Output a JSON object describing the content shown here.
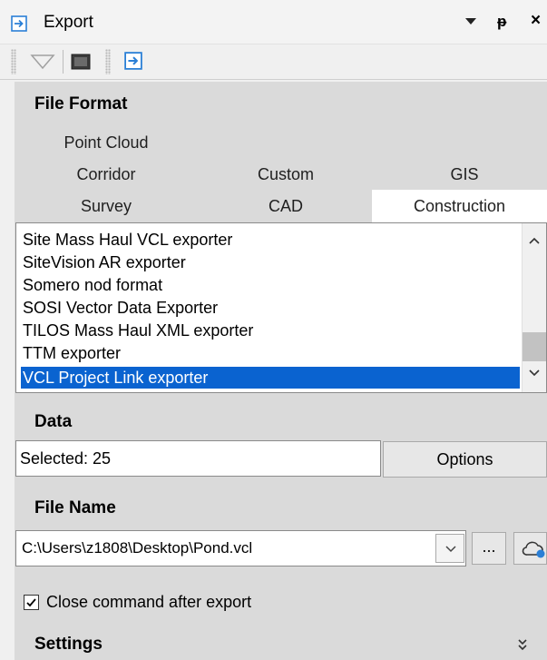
{
  "window": {
    "title": "Export"
  },
  "title_controls": {
    "dropdown": "dropdown-icon",
    "pin": "ᵽ",
    "close": "×"
  },
  "toolbar": {
    "items": [
      "filter-icon",
      "screen-icon",
      "export-icon"
    ]
  },
  "file_format": {
    "title": "File Format",
    "tabs_row1": [
      "Point Cloud"
    ],
    "tabs_row2": [
      "Corridor",
      "Custom",
      "GIS"
    ],
    "tabs_row3": [
      "Survey",
      "CAD",
      "Construction"
    ],
    "active_tab": "Construction",
    "list_items": [
      "Site Mass Haul VCL exporter",
      "SiteVision AR exporter",
      "Somero nod format",
      "SOSI Vector Data Exporter",
      "TILOS Mass Haul XML exporter",
      "TTM exporter",
      "VCL Project Link exporter"
    ],
    "selected_item": "VCL Project Link exporter"
  },
  "data_section": {
    "title": "Data",
    "selected_text": "Selected: 25",
    "options_button": "Options"
  },
  "file_name": {
    "title": "File Name",
    "path": "C:\\Users\\z1808\\Desktop\\Pond.vcl",
    "browse_label": "..."
  },
  "close_after_export": {
    "label": "Close command after export",
    "checked": true
  },
  "settings": {
    "title": "Settings"
  },
  "colors": {
    "selection": "#0a63d0",
    "panel": "#dadada",
    "background": "#f0f0f0"
  }
}
